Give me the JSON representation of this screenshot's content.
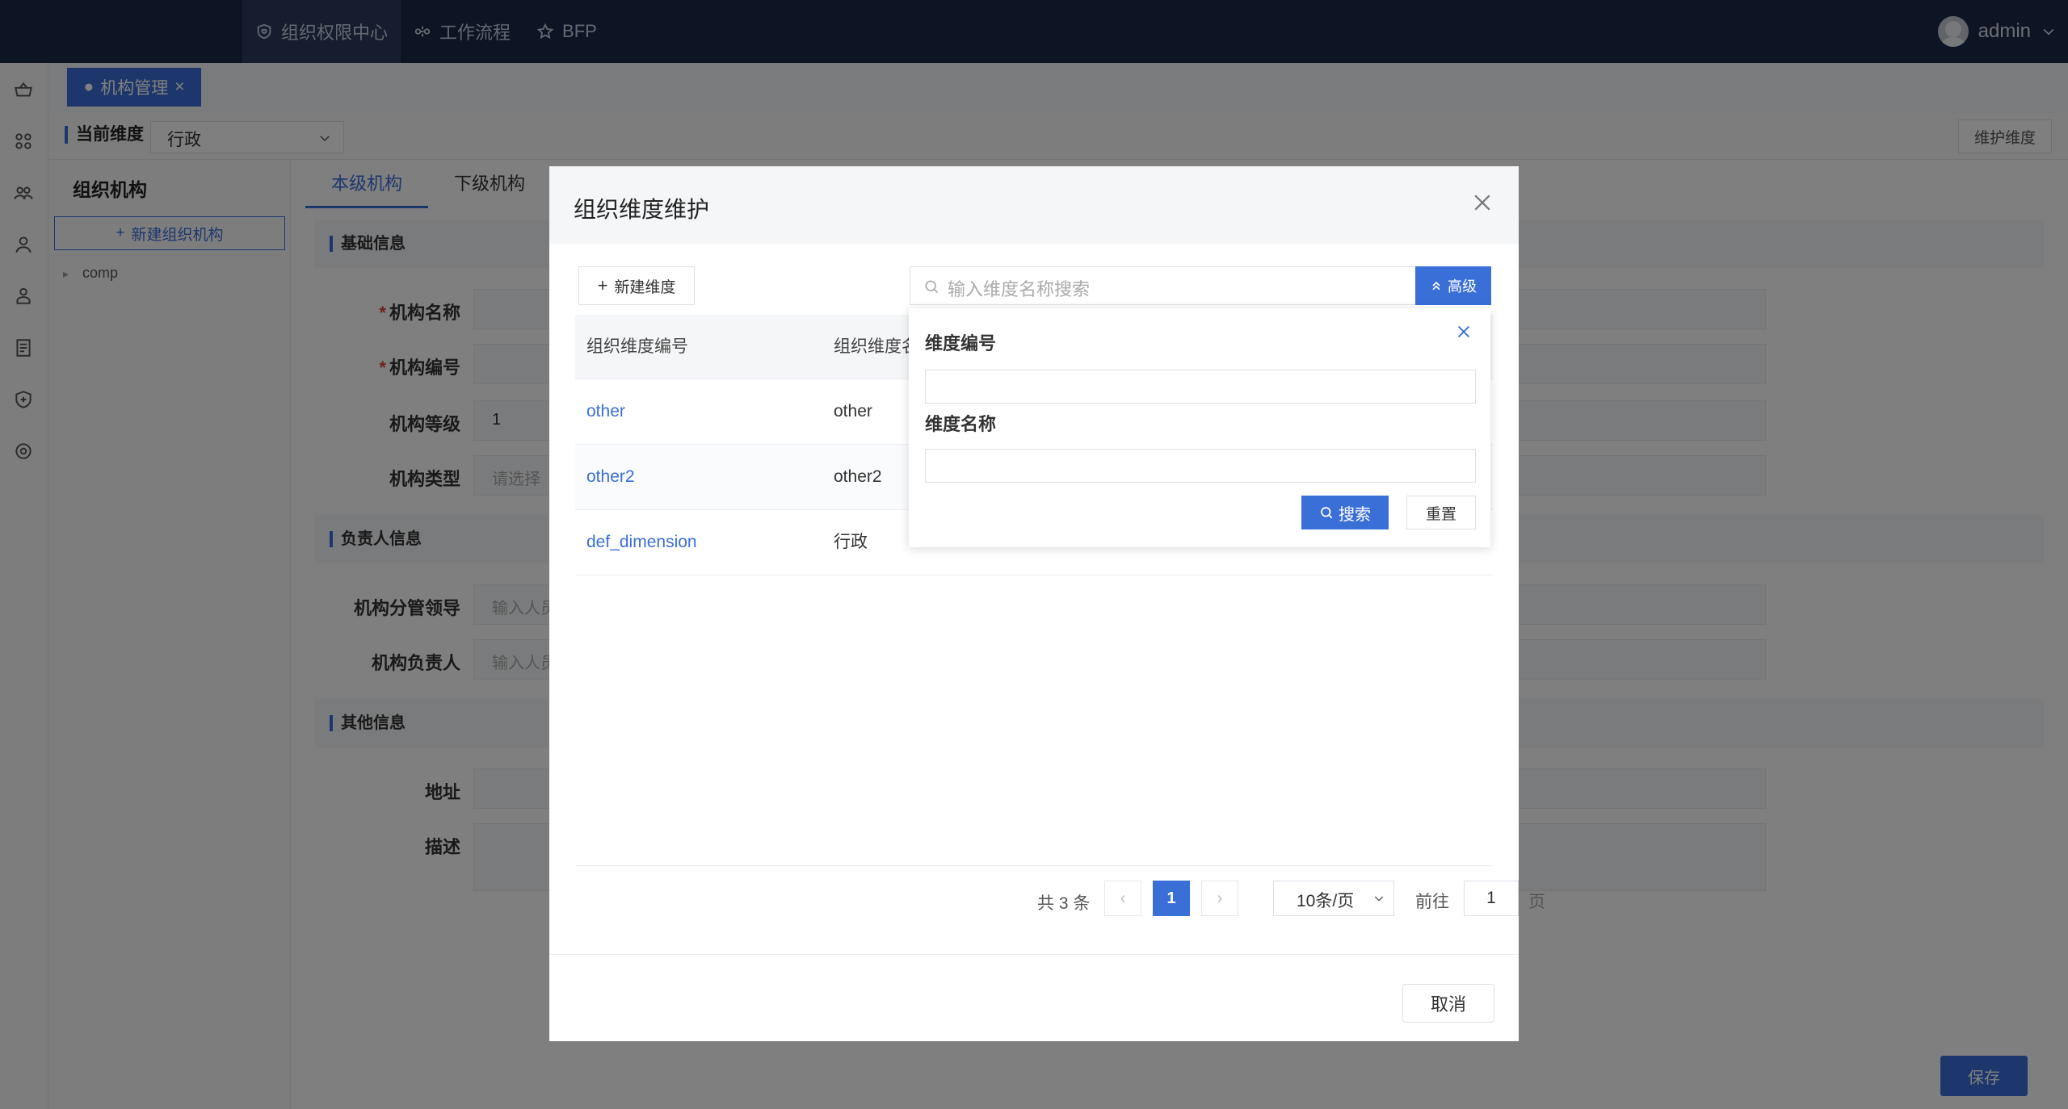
{
  "topnav": {
    "items": [
      {
        "label": "组织权限中心",
        "icon": "shield-heart-icon",
        "active": true
      },
      {
        "label": "工作流程",
        "icon": "workflow-icon",
        "active": false
      },
      {
        "label": "BFP",
        "icon": "star-icon",
        "active": false
      }
    ],
    "user": "admin"
  },
  "tabstrip": {
    "tab_label": "机构管理",
    "close": "×"
  },
  "dimbar": {
    "label": "当前维度",
    "value": "行政",
    "maintain_button": "维护维度"
  },
  "orgpanel": {
    "title": "组织机构",
    "new_button": "新建组织机构",
    "tree_root": "comp"
  },
  "main": {
    "tabs": [
      "本级机构",
      "下级机构"
    ],
    "sections": [
      "基础信息",
      "负责人信息",
      "其他信息"
    ],
    "fields": {
      "name": "机构名称",
      "code": "机构编号",
      "level": "机构等级",
      "level_value": "1",
      "type": "机构类型",
      "type_placeholder": "请选择",
      "leader": "机构分管领导",
      "leader_placeholder": "输入人员",
      "owner": "机构负责人",
      "owner_placeholder": "输入人员",
      "address": "地址",
      "desc": "描述"
    },
    "save_button": "保存"
  },
  "modal": {
    "title": "组织维度维护",
    "new_button": "新建维度",
    "search_placeholder": "输入维度名称搜索",
    "advanced_button": "高级",
    "columns": [
      "组织维度编号",
      "组织维度名称"
    ],
    "rows": [
      {
        "code": "other",
        "name": "other"
      },
      {
        "code": "other2",
        "name": "other2"
      },
      {
        "code": "def_dimension",
        "name": "行政"
      }
    ],
    "pager": {
      "total": "共 3 条",
      "current": "1",
      "page_size": "10条/页",
      "goto": "前往",
      "goto_value": "1",
      "unit": "页"
    },
    "cancel_button": "取消"
  },
  "advanced": {
    "code_label": "维度编号",
    "name_label": "维度名称",
    "search_button": "搜索",
    "reset_button": "重置"
  },
  "colors": {
    "primary": "#3a6fd8",
    "topbar": "#1b2a4a"
  }
}
